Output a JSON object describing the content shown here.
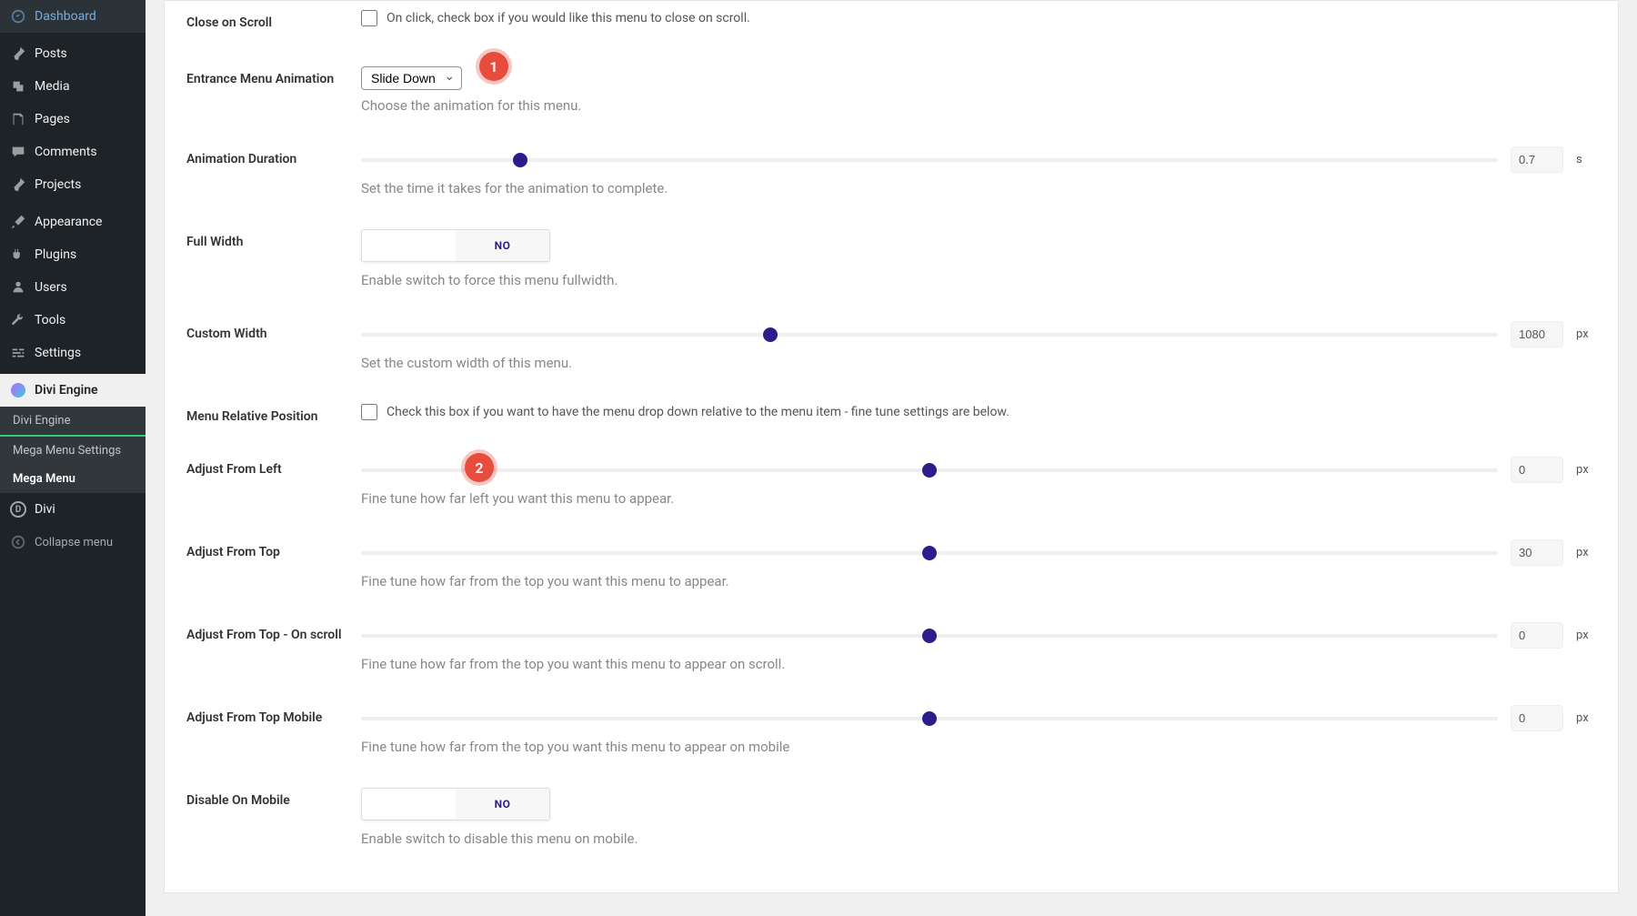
{
  "sidebar": {
    "items": [
      {
        "label": "Dashboard"
      },
      {
        "label": "Posts"
      },
      {
        "label": "Media"
      },
      {
        "label": "Pages"
      },
      {
        "label": "Comments"
      },
      {
        "label": "Projects"
      },
      {
        "label": "Appearance"
      },
      {
        "label": "Plugins"
      },
      {
        "label": "Users"
      },
      {
        "label": "Tools"
      },
      {
        "label": "Settings"
      },
      {
        "label": "Divi Engine"
      },
      {
        "label": "Divi"
      },
      {
        "label": "Collapse menu"
      }
    ],
    "submenu": [
      {
        "label": "Divi Engine"
      },
      {
        "label": "Mega Menu Settings"
      },
      {
        "label": "Mega Menu"
      }
    ]
  },
  "fields": {
    "close_on_scroll": {
      "label": "Close on Scroll",
      "text": "On click, check box if you would like this menu to close on scroll."
    },
    "entrance_animation": {
      "label": "Entrance Menu Animation",
      "value": "Slide Down",
      "desc": "Choose the animation for this menu."
    },
    "animation_duration": {
      "label": "Animation Duration",
      "value": "0.7",
      "unit": "s",
      "pos": 14,
      "desc": "Set the time it takes for the animation to complete."
    },
    "full_width": {
      "label": "Full Width",
      "no": "NO",
      "desc": "Enable switch to force this menu fullwidth."
    },
    "custom_width": {
      "label": "Custom Width",
      "value": "1080",
      "unit": "px",
      "pos": 36,
      "desc": "Set the custom width of this menu."
    },
    "menu_relative": {
      "label": "Menu Relative Position",
      "text": "Check this box if you want to have the menu drop down relative to the menu item - fine tune settings are below."
    },
    "adjust_left": {
      "label": "Adjust From Left",
      "value": "0",
      "unit": "px",
      "pos": 50,
      "desc": "Fine tune how far left you want this menu to appear."
    },
    "adjust_top": {
      "label": "Adjust From Top",
      "value": "30",
      "unit": "px",
      "pos": 50,
      "desc": "Fine tune how far from the top you want this menu to appear."
    },
    "adjust_top_scroll": {
      "label": "Adjust From Top - On scroll",
      "value": "0",
      "unit": "px",
      "pos": 50,
      "desc": "Fine tune how far from the top you want this menu to appear on scroll."
    },
    "adjust_top_mobile": {
      "label": "Adjust From Top Mobile",
      "value": "0",
      "unit": "px",
      "pos": 50,
      "desc": "Fine tune how far from the top you want this menu to appear on mobile"
    },
    "disable_mobile": {
      "label": "Disable On Mobile",
      "no": "NO",
      "desc": "Enable switch to disable this menu on mobile."
    }
  },
  "badges": {
    "one": "1",
    "two": "2"
  }
}
